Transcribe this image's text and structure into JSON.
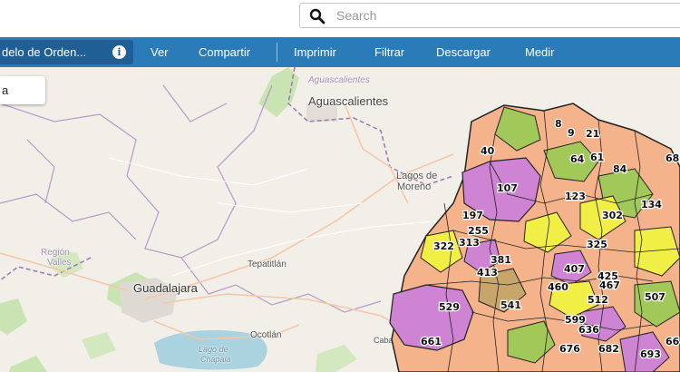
{
  "search": {
    "placeholder": "Search"
  },
  "toolbar": {
    "layer_select": "delo de Orden...",
    "menu": [
      "Ver",
      "Compartir",
      "Imprimir",
      "Filtrar",
      "Descargar",
      "Medir"
    ]
  },
  "side_panel": {
    "label": "a"
  },
  "map": {
    "places": {
      "aguascalientes": "Aguascalientes",
      "aguascalientes_state": "Aguascalientes",
      "lagos_line1": "Lagos de",
      "lagos_line2": "Moreno",
      "region_line1": "Región",
      "region_line2": "Valles",
      "guadalajara": "Guadalajara",
      "tepatitlan": "Tepatitlán",
      "ocotlan": "Ocotlán",
      "lago_line1": "Lago de",
      "lago_line2": "Chapala",
      "cabadas": "Cabad"
    },
    "polygon_labels": [
      "40",
      "107",
      "197",
      "255",
      "322",
      "313",
      "381",
      "413",
      "529",
      "541",
      "407",
      "425",
      "460",
      "467",
      "512",
      "599",
      "636",
      "661",
      "676",
      "682",
      "693",
      "66",
      "507",
      "325",
      "302",
      "123",
      "134",
      "64",
      "61",
      "84",
      "68",
      "21",
      "9",
      "8"
    ],
    "colors": {
      "water": "#aad3df",
      "park": "#c9e4b2",
      "salmon": "#f4b38b",
      "violet": "#cf84d3",
      "lime": "#a3c85a",
      "yellow": "#f1ee45",
      "ochre": "#c8a66b",
      "toolbar": "#2b7bb9"
    }
  }
}
